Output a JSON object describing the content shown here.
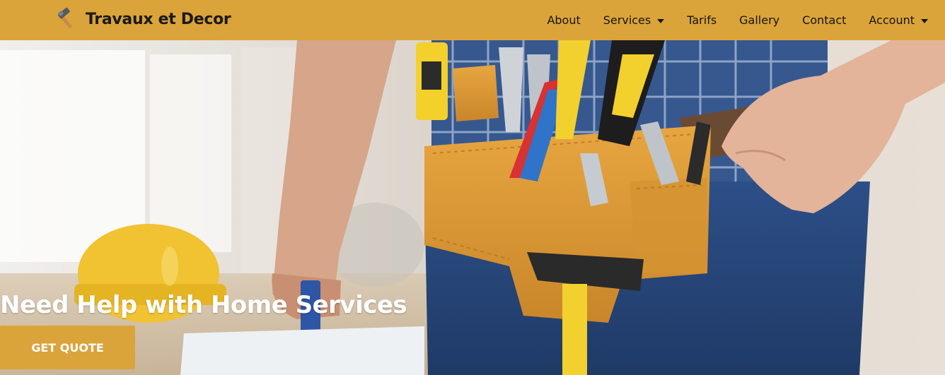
{
  "brand": {
    "name": "Travaux et Decor",
    "icon": "hammer-icon"
  },
  "nav": {
    "about": "About",
    "services": "Services",
    "tarifs": "Tarifs",
    "gallery": "Gallery",
    "contact": "Contact",
    "account": "Account"
  },
  "hero": {
    "title": "Need Help with Home Services",
    "cta_label": "GET QUOTE",
    "image_subject": "worker-with-tool-belt"
  },
  "colors": {
    "accent": "#dba43a",
    "text_dark": "#151515",
    "text_light": "#ffffff"
  }
}
